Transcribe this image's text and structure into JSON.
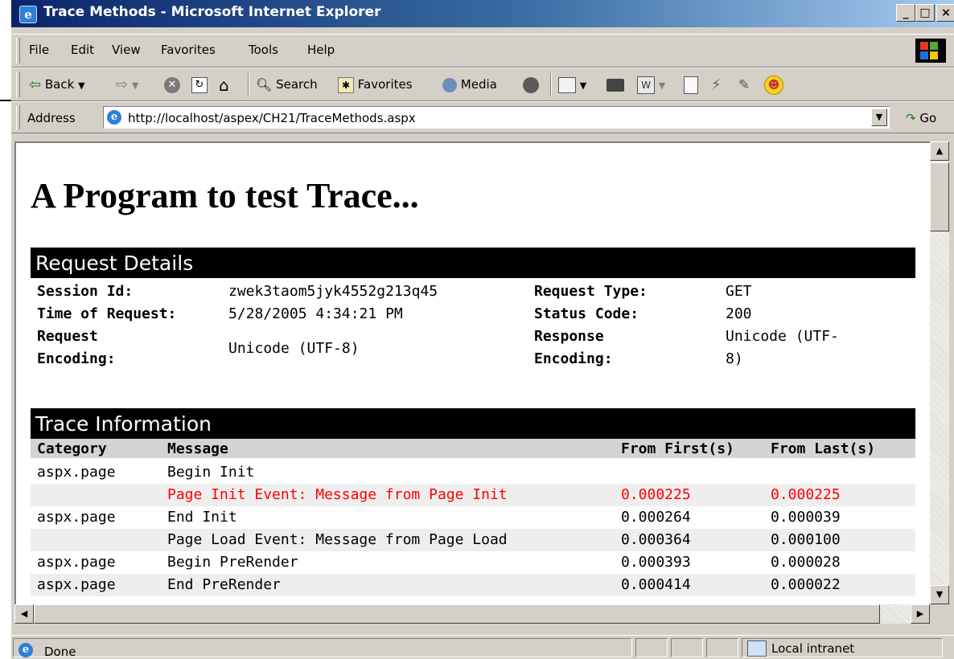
{
  "window": {
    "title": "Trace Methods - Microsoft Internet Explorer",
    "controls": {
      "minimize": "_",
      "maximize": "□",
      "close": "×"
    }
  },
  "menu": {
    "items": [
      "File",
      "Edit",
      "View",
      "Favorites",
      "Tools",
      "Help"
    ]
  },
  "toolbar": {
    "back_label": "Back",
    "search_label": "Search",
    "favorites_label": "Favorites",
    "media_label": "Media"
  },
  "address": {
    "label": "Address",
    "url": "http://localhost/aspex/CH21/TraceMethods.aspx",
    "go_label": "Go"
  },
  "page": {
    "heading": "A Program to test Trace...",
    "request_details": {
      "title": "Request Details",
      "session_id_label": "Session Id:",
      "session_id": "zwek3taom5jyk4552g213q45",
      "request_type_label": "Request Type:",
      "request_type": "GET",
      "time_label": "Time of Request:",
      "time": "5/28/2005 4:34:21 PM",
      "status_code_label": "Status Code:",
      "status_code": "200",
      "req_enc_label_1": "Request",
      "req_enc_label_2": "Encoding:",
      "req_enc": "Unicode (UTF-8)",
      "resp_enc_label_1": "Response",
      "resp_enc_label_2": "Encoding:",
      "resp_enc_1": "Unicode (UTF-",
      "resp_enc_2": "8)"
    },
    "trace": {
      "title": "Trace Information",
      "columns": [
        "Category",
        "Message",
        "From First(s)",
        "From Last(s)"
      ],
      "rows": [
        {
          "category": "aspx.page",
          "message": "Begin Init",
          "first": "",
          "last": ""
        },
        {
          "category": "",
          "message": "Page Init Event: Message from Page Init",
          "first": "0.000225",
          "last": "0.000225"
        },
        {
          "category": "aspx.page",
          "message": "End Init",
          "first": "0.000264",
          "last": "0.000039"
        },
        {
          "category": "",
          "message": "Page Load Event: Message from Page Load",
          "first": "0.000364",
          "last": "0.000100"
        },
        {
          "category": "aspx.page",
          "message": "Begin PreRender",
          "first": "0.000393",
          "last": "0.000028"
        },
        {
          "category": "aspx.page",
          "message": "End PreRender",
          "first": "0.000414",
          "last": "0.000022"
        }
      ]
    }
  },
  "status": {
    "text": "Done",
    "zone": "Local intranet"
  },
  "colors": {
    "warning_text": "#ff0000",
    "title_bar": "#0a246a"
  }
}
